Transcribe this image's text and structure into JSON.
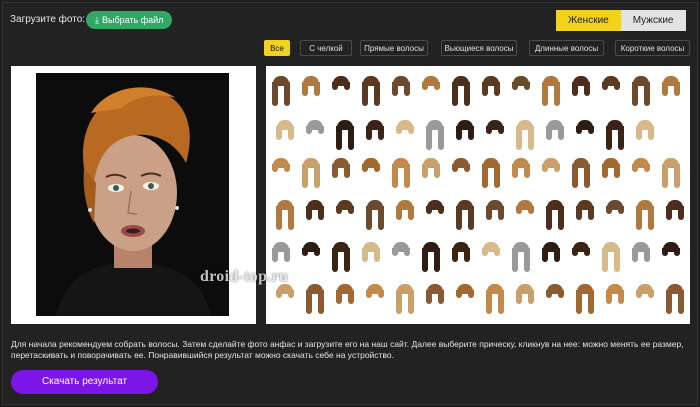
{
  "upload": {
    "label": "Загрузите фото:",
    "button_label": "Выбрать файл",
    "button_icon": "download-icon"
  },
  "gender": {
    "female": "Женские",
    "male": "Мужские",
    "selected": "female"
  },
  "filters": [
    "Все",
    "С челкой",
    "Прямые волосы",
    "Вьющиеся волосы",
    "Длинные волосы",
    "Короткие волосы"
  ],
  "active_filter": 0,
  "watermark": "droid-top.ru",
  "description": "Для начала рекомендуем собрать волосы. Затем сделайте фото анфас и загрузите его на наш сайт. Далее выберите прическу, кликнув на нее: можно менять ее размер, перетаскивать и поворачивать ее. Понравившийся результат можно скачать себе на устройство.",
  "download_label": "Скачать результат",
  "colors": {
    "accent_yellow": "#f3d21b",
    "upload_green": "#2fa866",
    "download_purple": "#7b16e6",
    "background": "#222222"
  },
  "hair_colors": [
    "#6b4a2e",
    "#c9a06a",
    "#3a2416",
    "#b0793f",
    "#8a5a33",
    "#d8b98a",
    "#4b2e1c",
    "#a0692f",
    "#9a9a9a",
    "#5a3a22",
    "#c48a4c",
    "#2d1d12"
  ]
}
